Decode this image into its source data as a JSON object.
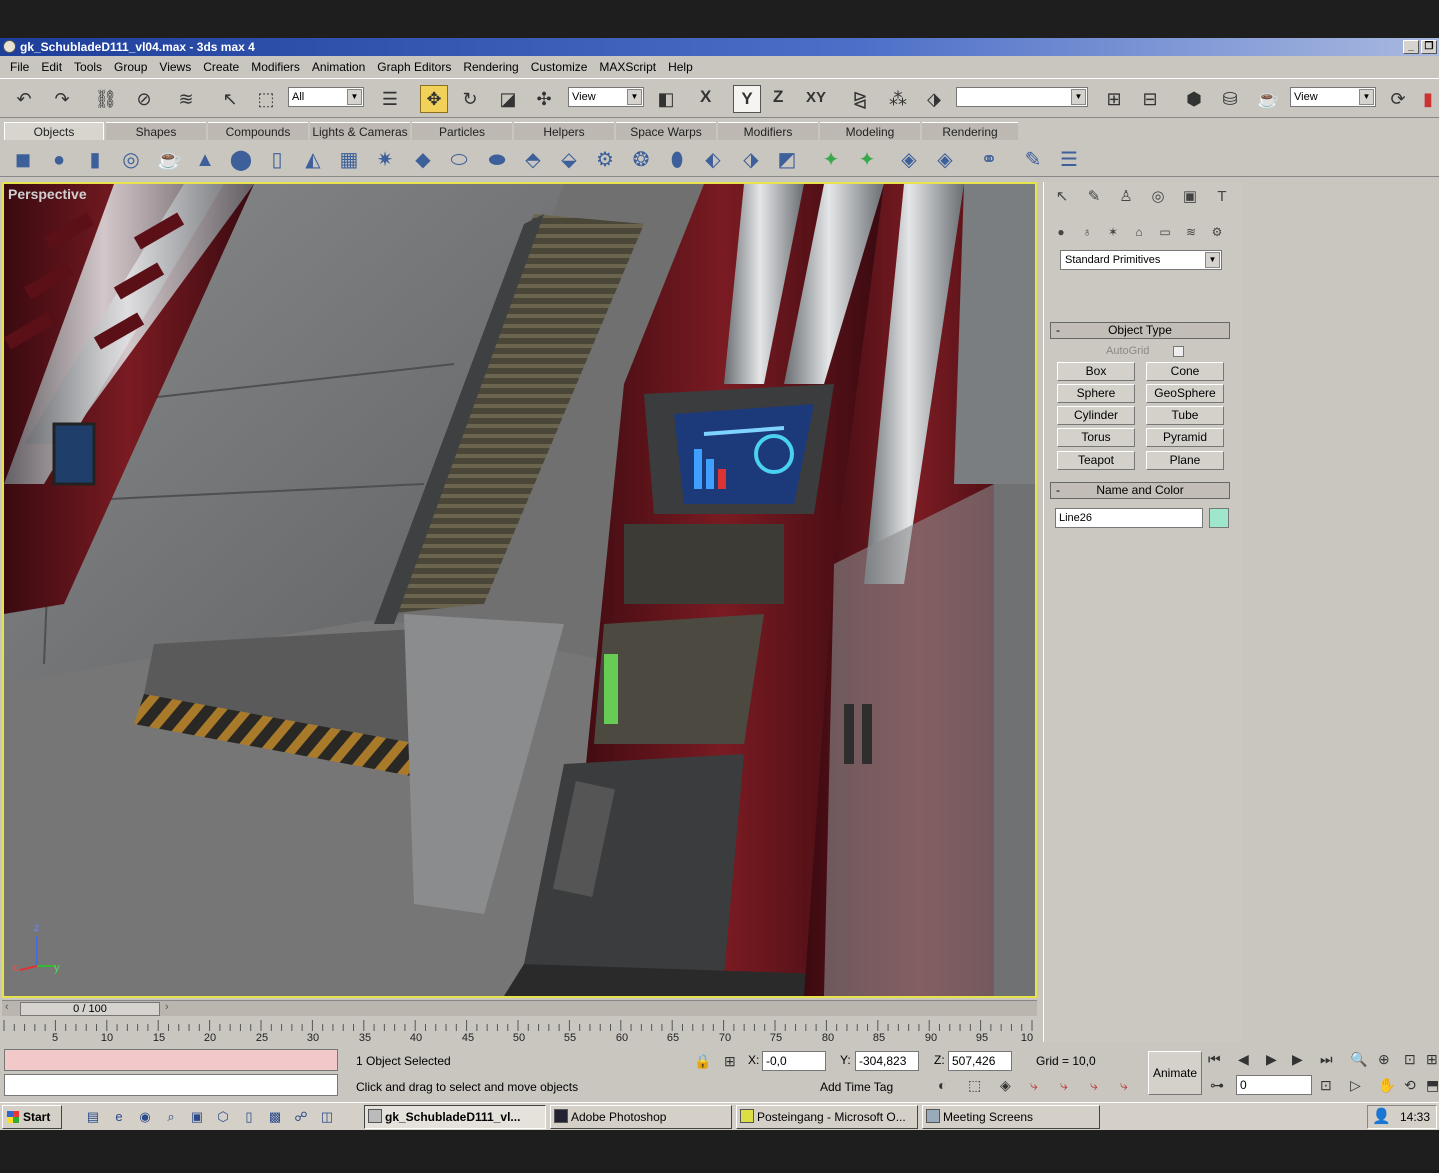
{
  "window": {
    "title": "gk_SchubladeD111_vl04.max - 3ds max 4"
  },
  "menu": [
    "File",
    "Edit",
    "Tools",
    "Group",
    "Views",
    "Create",
    "Modifiers",
    "Animation",
    "Graph Editors",
    "Rendering",
    "Customize",
    "MAXScript",
    "Help"
  ],
  "toolbar": {
    "selection_filter": "All",
    "ref_coord_1": "View",
    "named_selection": "",
    "ref_coord_2": "View",
    "axis_x": "X",
    "axis_y": "Y",
    "axis_z": "Z",
    "axis_xy": "XY"
  },
  "tabs": [
    "Objects",
    "Shapes",
    "Compounds",
    "Lights & Cameras",
    "Particles",
    "Helpers",
    "Space Warps",
    "Modifiers",
    "Modeling",
    "Rendering"
  ],
  "viewport": {
    "label": "Perspective",
    "axis_z": "z",
    "axis_x": "x",
    "axis_y": "y"
  },
  "command_panel": {
    "category": "Standard Primitives",
    "object_type_title": "Object Type",
    "autogrid": "AutoGrid",
    "buttons": [
      "Box",
      "Cone",
      "Sphere",
      "GeoSphere",
      "Cylinder",
      "Tube",
      "Torus",
      "Pyramid",
      "Teapot",
      "Plane"
    ],
    "name_color_title": "Name and Color",
    "object_name": "Line26",
    "object_color": "#9ee6cc",
    "collapse": "-"
  },
  "timeline": {
    "frame_display": "0 / 100",
    "ticks": [
      "5",
      "10",
      "15",
      "20",
      "25",
      "30",
      "35",
      "40",
      "45",
      "50",
      "55",
      "60",
      "65",
      "70",
      "75",
      "80",
      "85",
      "90",
      "95",
      "10"
    ]
  },
  "status": {
    "selection": "1 Object Selected",
    "prompt": "Click and drag to select and move objects",
    "x_label": "X:",
    "x_value": "-0,0",
    "y_label": "Y:",
    "y_value": "-304,823",
    "z_label": "Z:",
    "z_value": "507,426",
    "grid": "Grid = 10,0",
    "add_time_tag": "Add Time Tag",
    "animate": "Animate",
    "current_frame": "0"
  },
  "taskbar": {
    "start": "Start",
    "tasks": [
      "gk_SchubladeD111_vl...",
      "Adobe Photoshop",
      "Posteingang - Microsoft O...",
      "Meeting Screens"
    ],
    "clock": "14:33"
  },
  "colors": {
    "viewport_border": "#e6e44a",
    "title_bar": "#1d3f9a",
    "maxscript_listener": "#f2c8c8"
  }
}
